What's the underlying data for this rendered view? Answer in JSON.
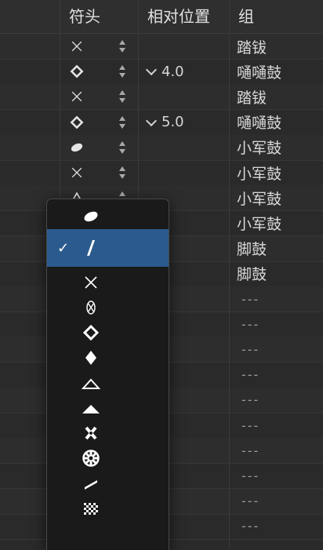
{
  "header": {
    "col_notehead": "符头",
    "col_relative_position": "相对位置",
    "col_group": "组"
  },
  "rows": [
    {
      "symbol": "x-notehead-icon",
      "relative_position": "",
      "group": "踏钹"
    },
    {
      "symbol": "diamond-notehead-icon",
      "relative_position": "4.0",
      "group": "嗵嗵鼓"
    },
    {
      "symbol": "x-notehead-icon",
      "relative_position": "",
      "group": "踏钹"
    },
    {
      "symbol": "diamond-notehead-icon",
      "relative_position": "5.0",
      "group": "嗵嗵鼓"
    },
    {
      "symbol": "oval-notehead-icon",
      "relative_position": "",
      "group": "小军鼓"
    },
    {
      "symbol": "x-notehead-icon",
      "relative_position": "",
      "group": "小军鼓"
    },
    {
      "symbol": "triangle-notehead-icon",
      "relative_position": "",
      "group": "小军鼓"
    },
    {
      "symbol": "",
      "relative_position": "",
      "group": "小军鼓"
    },
    {
      "symbol": "",
      "relative_position": "",
      "group": "脚鼓"
    },
    {
      "symbol": "",
      "relative_position": "",
      "group": "脚鼓"
    },
    {
      "symbol": "",
      "relative_position": "",
      "group": "---"
    },
    {
      "symbol": "",
      "relative_position": "",
      "group": "---"
    },
    {
      "symbol": "",
      "relative_position": "",
      "group": "---"
    },
    {
      "symbol": "",
      "relative_position": "",
      "group": "---"
    },
    {
      "symbol": "",
      "relative_position": "",
      "group": "---"
    },
    {
      "symbol": "",
      "relative_position": "",
      "group": "---"
    },
    {
      "symbol": "",
      "relative_position": "",
      "group": "---"
    },
    {
      "symbol": "",
      "relative_position": "",
      "group": "---"
    },
    {
      "symbol": "",
      "relative_position": "",
      "group": "---"
    },
    {
      "symbol": "",
      "relative_position": "",
      "group": "---"
    }
  ],
  "notehead_menu": {
    "checkmark": "✓",
    "selected_index": 1,
    "items": [
      "filled-oval-notehead-icon",
      "slash-notehead-icon",
      "x-notehead-icon",
      "circled-x-notehead-icon",
      "diamond-notehead-icon",
      "filled-diamond-notehead-icon",
      "triangle-outline-notehead-icon",
      "filled-triangle-notehead-icon",
      "bold-x-notehead-icon",
      "circle-cross-notehead-icon",
      "thin-slash-notehead-icon",
      "checkered-notehead-icon"
    ]
  },
  "colors": {
    "background": "#2a2a2a",
    "menu_background": "#1a1a1a",
    "selection": "#2b5b8e",
    "text": "#d8d8d8"
  }
}
